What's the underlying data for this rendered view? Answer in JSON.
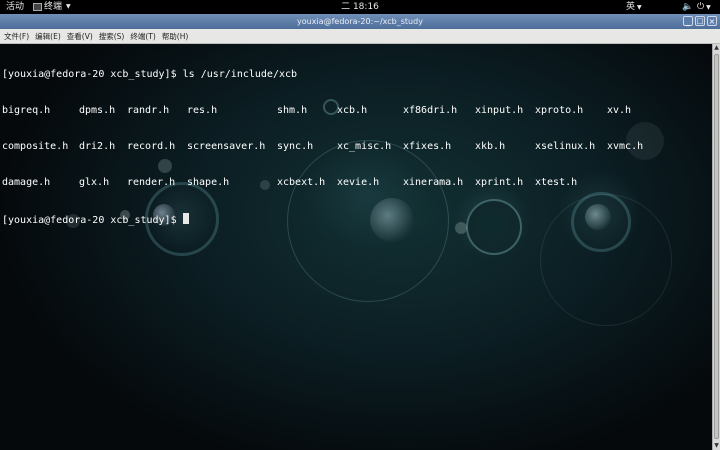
{
  "topbar": {
    "activities": "活动",
    "app_menu": "终端",
    "clock": "二 18:16",
    "input_method": "英",
    "icons": {
      "app": "terminal-icon",
      "volume": "volume-icon",
      "power": "power-icon",
      "caret": "chevron-down-icon"
    }
  },
  "window": {
    "title": "youxia@fedora-20:~/xcb_study",
    "controls": [
      "minimize",
      "maximize",
      "close"
    ]
  },
  "menu": {
    "items": [
      "文件(F)",
      "编辑(E)",
      "查看(V)",
      "搜索(S)",
      "终端(T)",
      "帮助(H)"
    ]
  },
  "terminal": {
    "prompt": "[youxia@fedora-20 xcb_study]$",
    "command": "ls /usr/include/xcb",
    "columns": [
      [
        "bigreq.h",
        "composite.h",
        "damage.h"
      ],
      [
        "dpms.h",
        "dri2.h",
        "glx.h"
      ],
      [
        "randr.h",
        "record.h",
        "render.h"
      ],
      [
        "res.h",
        "screensaver.h",
        "shape.h"
      ],
      [
        "shm.h",
        "sync.h",
        "xcbext.h"
      ],
      [
        "xcb.h",
        "xc_misc.h",
        "xevie.h"
      ],
      [
        "xf86dri.h",
        "xfixes.h",
        "xinerama.h"
      ],
      [
        "xinput.h",
        "xkb.h",
        "xprint.h"
      ],
      [
        "xproto.h",
        "xselinux.h",
        "xtest.h"
      ],
      [
        "xv.h",
        "xvmc.h",
        ""
      ]
    ],
    "final_prompt": "[youxia@fedora-20 xcb_study]$"
  }
}
